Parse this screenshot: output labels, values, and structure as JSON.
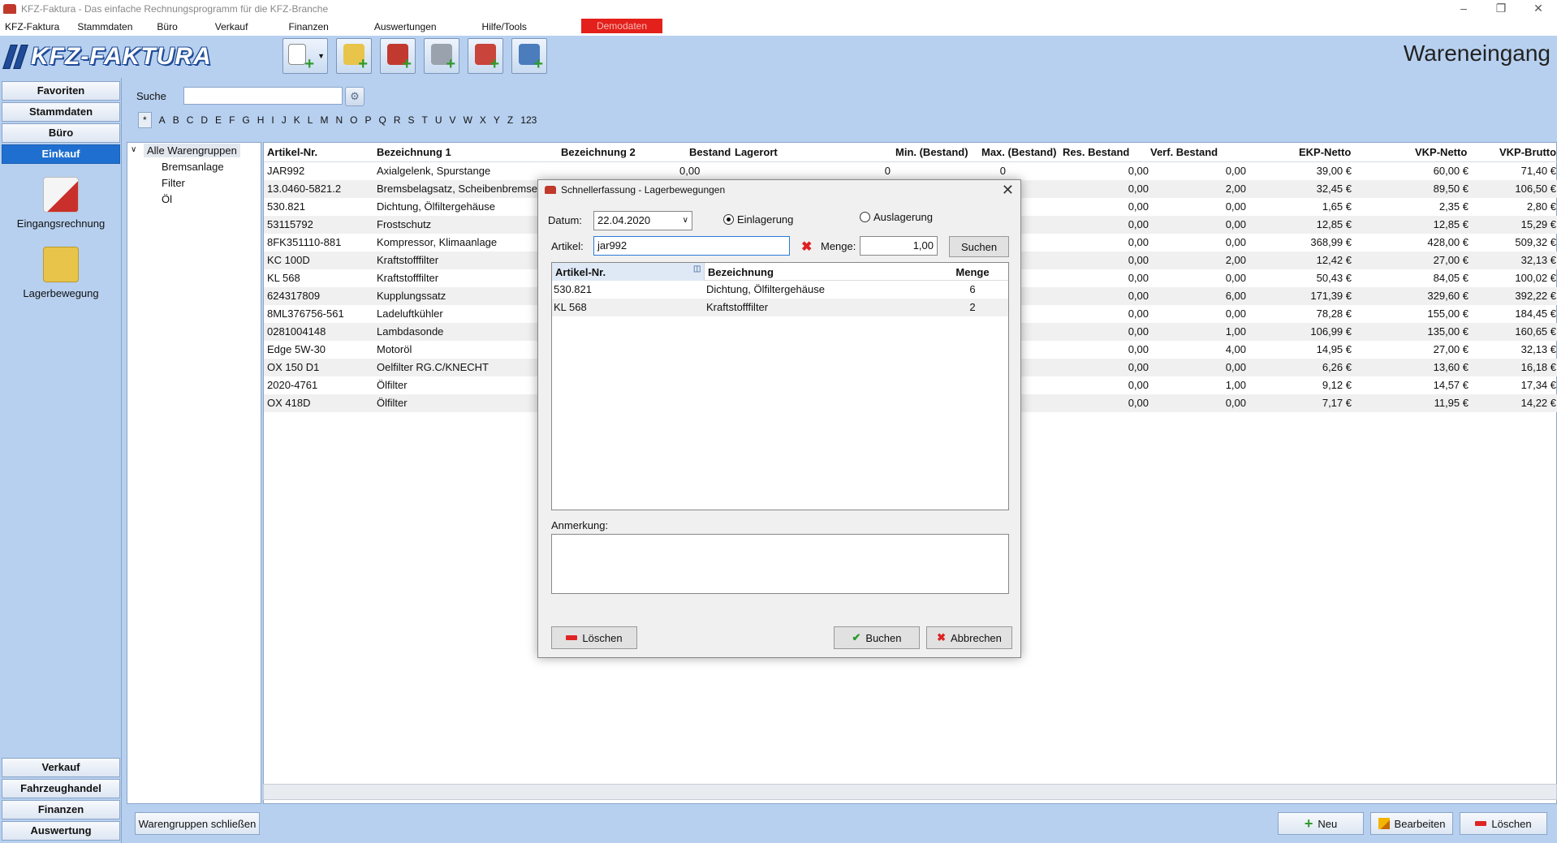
{
  "window": {
    "title": "KFZ-Faktura - Das einfache Rechnungsprogramm für die KFZ-Branche"
  },
  "menu": [
    "KFZ-Faktura",
    "Stammdaten",
    "Büro",
    "Verkauf",
    "Finanzen",
    "Auswertungen",
    "Hilfe/Tools"
  ],
  "demo_badge": "Demodaten",
  "logo_text": "KFZ-FAKTURA",
  "page_title": "Wareneingang",
  "toolbar_icons": [
    "new-document-icon",
    "add-customer-icon",
    "add-vehicle-icon",
    "add-part-icon",
    "add-service-icon",
    "add-truck-icon"
  ],
  "nav": {
    "top": [
      "Favoriten",
      "Stammdaten",
      "Büro",
      "Einkauf"
    ],
    "active": "Einkauf",
    "items": [
      {
        "label": "Eingangsrechnung",
        "icon": "invoice-in-icon"
      },
      {
        "label": "Lagerbewegung",
        "icon": "stock-move-icon"
      }
    ],
    "bottom": [
      "Verkauf",
      "Fahrzeughandel",
      "Finanzen",
      "Auswertung"
    ]
  },
  "search": {
    "label": "Suche",
    "value": ""
  },
  "alphabet": [
    "*",
    "A",
    "B",
    "C",
    "D",
    "E",
    "F",
    "G",
    "H",
    "I",
    "J",
    "K",
    "L",
    "M",
    "N",
    "O",
    "P",
    "Q",
    "R",
    "S",
    "T",
    "U",
    "V",
    "W",
    "X",
    "Y",
    "Z",
    "123"
  ],
  "tree": {
    "root": "Alle Warengruppen",
    "children": [
      "Bremsanlage",
      "Filter",
      "Öl"
    ]
  },
  "grid": {
    "columns": [
      "Artikel-Nr.",
      "Bezeichnung 1",
      "Bezeichnung 2",
      "Bestand",
      "Lagerort",
      "Min. (Bestand)",
      "Max. (Bestand)",
      "Res. Bestand",
      "Verf. Bestand",
      "EKP-Netto",
      "VKP-Netto",
      "VKP-Brutto"
    ],
    "first_row_extra": {
      "bestand": "0,00",
      "min": "0",
      "max": "0"
    },
    "rows": [
      {
        "nr": "JAR992",
        "bez": "Axialgelenk, Spurstange",
        "res": "0,00",
        "verf": "0,00",
        "ekp": "39,00 €",
        "vkp": "60,00 €",
        "brutto": "71,40 €"
      },
      {
        "nr": "13.0460-5821.2",
        "bez": "Bremsbelagsatz, Scheibenbremse",
        "res": "0,00",
        "verf": "2,00",
        "ekp": "32,45 €",
        "vkp": "89,50 €",
        "brutto": "106,50 €"
      },
      {
        "nr": "530.821",
        "bez": "Dichtung, Ölfiltergehäuse",
        "res": "0,00",
        "verf": "0,00",
        "ekp": "1,65 €",
        "vkp": "2,35 €",
        "brutto": "2,80 €"
      },
      {
        "nr": "53115792",
        "bez": "Frostschutz",
        "res": "0,00",
        "verf": "0,00",
        "ekp": "12,85 €",
        "vkp": "12,85 €",
        "brutto": "15,29 €"
      },
      {
        "nr": "8FK351110-881",
        "bez": "Kompressor, Klimaanlage",
        "res": "0,00",
        "verf": "0,00",
        "ekp": "368,99 €",
        "vkp": "428,00 €",
        "brutto": "509,32 €"
      },
      {
        "nr": "KC 100D",
        "bez": "Kraftstofffilter",
        "res": "0,00",
        "verf": "2,00",
        "ekp": "12,42 €",
        "vkp": "27,00 €",
        "brutto": "32,13 €"
      },
      {
        "nr": "KL 568",
        "bez": "Kraftstofffilter",
        "res": "0,00",
        "verf": "0,00",
        "ekp": "50,43 €",
        "vkp": "84,05 €",
        "brutto": "100,02 €"
      },
      {
        "nr": "624317809",
        "bez": "Kupplungssatz",
        "res": "0,00",
        "verf": "6,00",
        "ekp": "171,39 €",
        "vkp": "329,60 €",
        "brutto": "392,22 €"
      },
      {
        "nr": "8ML376756-561",
        "bez": "Ladeluftkühler",
        "res": "0,00",
        "verf": "0,00",
        "ekp": "78,28 €",
        "vkp": "155,00 €",
        "brutto": "184,45 €"
      },
      {
        "nr": "0281004148",
        "bez": "Lambdasonde",
        "res": "0,00",
        "verf": "1,00",
        "ekp": "106,99 €",
        "vkp": "135,00 €",
        "brutto": "160,65 €"
      },
      {
        "nr": "Edge 5W-30",
        "bez": "Motoröl",
        "res": "0,00",
        "verf": "4,00",
        "ekp": "14,95 €",
        "vkp": "27,00 €",
        "brutto": "32,13 €"
      },
      {
        "nr": "OX 150 D1",
        "bez": "Oelfilter RG.C/KNECHT",
        "res": "0,00",
        "verf": "0,00",
        "ekp": "6,26 €",
        "vkp": "13,60 €",
        "brutto": "16,18 €"
      },
      {
        "nr": "2020-4761",
        "bez": "Ölfilter",
        "res": "0,00",
        "verf": "1,00",
        "ekp": "9,12 €",
        "vkp": "14,57 €",
        "brutto": "17,34 €"
      },
      {
        "nr": "OX 418D",
        "bez": "Ölfilter",
        "res": "0,00",
        "verf": "0,00",
        "ekp": "7,17 €",
        "vkp": "11,95 €",
        "brutto": "14,22 €"
      }
    ]
  },
  "bottom_buttons": {
    "close_groups": "Warengruppen schließen",
    "new": "Neu",
    "edit": "Bearbeiten",
    "delete": "Löschen"
  },
  "dialog": {
    "title": "Schnellerfassung - Lagerbewegungen",
    "datum_label": "Datum:",
    "datum_value": "22.04.2020",
    "radio_in": "Einlagerung",
    "radio_out": "Auslagerung",
    "radio_selected": "Einlagerung",
    "artikel_label": "Artikel:",
    "artikel_value": "jar992",
    "menge_label": "Menge:",
    "menge_value": "1,00",
    "search_button": "Suchen",
    "columns": [
      "Artikel-Nr.",
      "Bezeichnung",
      "Menge"
    ],
    "rows": [
      {
        "nr": "530.821",
        "bez": "Dichtung, Ölfiltergehäuse",
        "menge": "6"
      },
      {
        "nr": "KL 568",
        "bez": "Kraftstofffilter",
        "menge": "2"
      }
    ],
    "anmerkung_label": "Anmerkung:",
    "anmerkung_value": "",
    "delete_button": "Löschen",
    "book_button": "Buchen",
    "cancel_button": "Abbrechen"
  }
}
